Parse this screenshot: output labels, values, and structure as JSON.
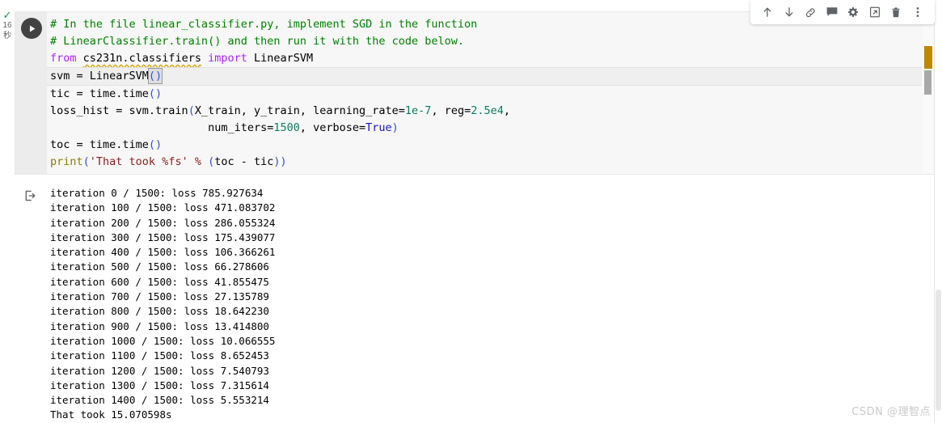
{
  "toolbar": {
    "buttons": [
      {
        "name": "move-cell-up-icon",
        "label": "Move cell up"
      },
      {
        "name": "move-cell-down-icon",
        "label": "Move cell down"
      },
      {
        "name": "link-to-cell-icon",
        "label": "Link to cell"
      },
      {
        "name": "comment-icon",
        "label": "Add comment"
      },
      {
        "name": "gear-icon",
        "label": "Cell settings"
      },
      {
        "name": "mirror-cell-icon",
        "label": "Mirror cell in tab"
      },
      {
        "name": "delete-cell-icon",
        "label": "Delete cell"
      },
      {
        "name": "more-options-icon",
        "label": "More cell actions"
      }
    ]
  },
  "run_status": {
    "check": "✓",
    "elapsed": "16",
    "unit": "秒"
  },
  "code_cell": {
    "run_button_label": "Run cell",
    "lines": [
      {
        "id": "l1",
        "active": false,
        "tokens": [
          {
            "cls": "tok-comment",
            "text": "# In the file linear_classifier.py, implement SGD in the function"
          }
        ]
      },
      {
        "id": "l2",
        "active": false,
        "tokens": [
          {
            "cls": "tok-comment",
            "text": "# LinearClassifier.train() and then run it with the code below."
          }
        ]
      },
      {
        "id": "l3",
        "active": false,
        "tokens": [
          {
            "cls": "tok-kw",
            "text": "from"
          },
          {
            "cls": "tok-plain",
            "text": " "
          },
          {
            "cls": "tok-plain squiggly",
            "text": "cs231n.classifiers"
          },
          {
            "cls": "tok-plain",
            "text": " "
          },
          {
            "cls": "tok-kw",
            "text": "import"
          },
          {
            "cls": "tok-plain",
            "text": " LinearSVM"
          }
        ]
      },
      {
        "id": "l4",
        "active": true,
        "tokens": [
          {
            "cls": "tok-plain",
            "text": "svm = LinearSVM"
          },
          {
            "cls": "tok-paren cursor-box",
            "text": "()"
          }
        ]
      },
      {
        "id": "l5",
        "active": false,
        "tokens": [
          {
            "cls": "tok-plain",
            "text": "tic = time.time"
          },
          {
            "cls": "tok-paren",
            "text": "()"
          }
        ]
      },
      {
        "id": "l6",
        "active": false,
        "tokens": [
          {
            "cls": "tok-plain",
            "text": "loss_hist = svm.train"
          },
          {
            "cls": "tok-paren",
            "text": "("
          },
          {
            "cls": "tok-plain",
            "text": "X_train, y_train, learning_rate="
          },
          {
            "cls": "tok-num",
            "text": "1e-7"
          },
          {
            "cls": "tok-plain",
            "text": ", reg="
          },
          {
            "cls": "tok-num",
            "text": "2.5e4"
          },
          {
            "cls": "tok-plain",
            "text": ","
          }
        ]
      },
      {
        "id": "l7",
        "active": false,
        "tokens": [
          {
            "cls": "tok-plain",
            "text": "                        num_iters="
          },
          {
            "cls": "tok-num",
            "text": "1500"
          },
          {
            "cls": "tok-plain",
            "text": ", verbose="
          },
          {
            "cls": "tok-bool",
            "text": "True"
          },
          {
            "cls": "tok-paren",
            "text": ")"
          }
        ]
      },
      {
        "id": "l8",
        "active": false,
        "tokens": [
          {
            "cls": "tok-plain",
            "text": "toc = time.time"
          },
          {
            "cls": "tok-paren",
            "text": "()"
          }
        ]
      },
      {
        "id": "l9",
        "active": false,
        "tokens": [
          {
            "cls": "tok-fn",
            "text": "print"
          },
          {
            "cls": "tok-paren",
            "text": "("
          },
          {
            "cls": "tok-str",
            "text": "'That took %fs'"
          },
          {
            "cls": "tok-plain",
            "text": " "
          },
          {
            "cls": "tok-str",
            "text": "%"
          },
          {
            "cls": "tok-plain",
            "text": " "
          },
          {
            "cls": "tok-paren",
            "text": "("
          },
          {
            "cls": "tok-plain",
            "text": "toc - tic"
          },
          {
            "cls": "tok-paren",
            "text": "))"
          }
        ]
      }
    ]
  },
  "output": {
    "icon_name": "output-stream-icon",
    "lines": [
      "iteration 0 / 1500: loss 785.927634",
      "iteration 100 / 1500: loss 471.083702",
      "iteration 200 / 1500: loss 286.055324",
      "iteration 300 / 1500: loss 175.439077",
      "iteration 400 / 1500: loss 106.366261",
      "iteration 500 / 1500: loss 66.278606",
      "iteration 600 / 1500: loss 41.855475",
      "iteration 700 / 1500: loss 27.135789",
      "iteration 800 / 1500: loss 18.642230",
      "iteration 900 / 1500: loss 13.414800",
      "iteration 1000 / 1500: loss 10.066555",
      "iteration 1100 / 1500: loss 8.652453",
      "iteration 1200 / 1500: loss 7.540793",
      "iteration 1300 / 1500: loss 7.315614",
      "iteration 1400 / 1500: loss 5.553214",
      "That took 15.070598s"
    ]
  },
  "watermark": {
    "text": "CSDN @理智点"
  },
  "colors": {
    "comment": "#008000",
    "keyword": "#aa22ff",
    "number": "#0e7a5f",
    "boolean": "#1414d4",
    "string": "#8b2020",
    "function": "#8a7b00",
    "marker": "#bf8700",
    "success": "#1e8e3e"
  }
}
